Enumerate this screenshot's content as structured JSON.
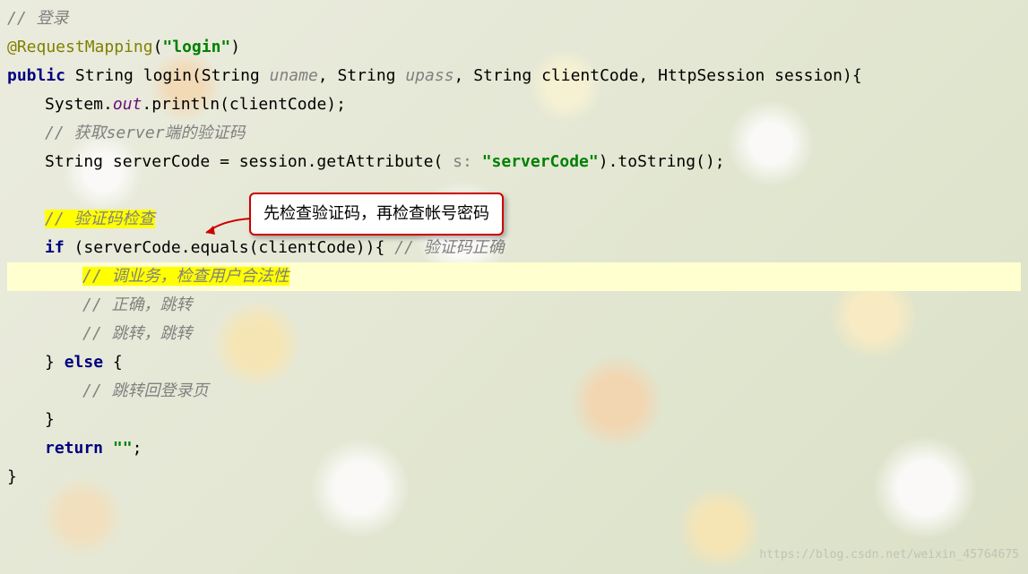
{
  "code": {
    "line1_comment": "// 登录",
    "line2_annotation": "@RequestMapping",
    "line2_paren_open": "(",
    "line2_string": "\"login\"",
    "line2_paren_close": ")",
    "line3_public": "public",
    "line3_1": " String login(String ",
    "line3_uname": "uname",
    "line3_2": ", String ",
    "line3_upass": "upass",
    "line3_3": ", String clientCode, HttpSession session){",
    "line4_1": "System.",
    "line4_out": "out",
    "line4_2": ".println(clientCode);",
    "line5_comment": "// 获取server端的验证码",
    "line6_1": "String serverCode = session.getAttribute(",
    "line6_hint": " s: ",
    "line6_string": "\"serverCode\"",
    "line6_2": ").toString();",
    "line8_comment": "// 验证码检查",
    "line9_if": "if",
    "line9_1": " (serverCode.equals(clientCode)){ ",
    "line9_comment": "// 验证码正确",
    "line10_comment": "// 调业务，检查用户合法性",
    "line11_comment": "// 正确，跳转",
    "line12_comment": "// 跳转，跳转",
    "line13_1": "} ",
    "line13_else": "else",
    "line13_2": " {",
    "line14_comment": "// 跳转回登录页",
    "line15_1": "}",
    "line16_return": "return",
    "line16_1": " ",
    "line16_string": "\"\"",
    "line16_2": ";",
    "line17_1": "}"
  },
  "callout": {
    "text": "先检查验证码，再检查帐号密码"
  },
  "watermark": {
    "text": "https://blog.csdn.net/weixin_45764675"
  }
}
